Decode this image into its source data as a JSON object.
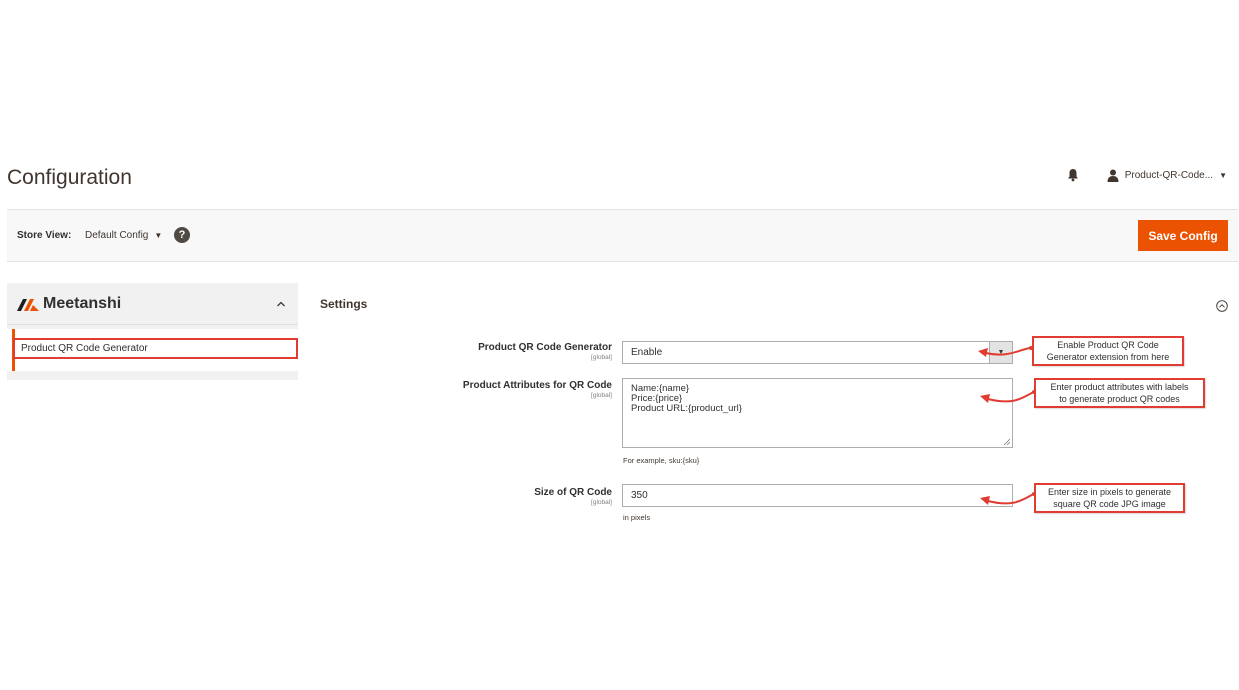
{
  "page": {
    "title": "Configuration"
  },
  "header": {
    "notifications_icon": "bell-icon",
    "user_label": "Product-QR-Code...",
    "user_icon": "user-icon"
  },
  "scope_bar": {
    "store_view_label": "Store View:",
    "store_view_value": "Default Config",
    "help_icon": "question-icon",
    "help_glyph": "?",
    "save_label": "Save Config"
  },
  "sidebar": {
    "brand": "Meetanshi",
    "items": [
      {
        "label": "Product QR Code Generator",
        "active": true
      }
    ]
  },
  "section": {
    "title": "Settings"
  },
  "fields": {
    "generator": {
      "label": "Product QR Code Generator",
      "scope": "[global]",
      "value": "Enable"
    },
    "attributes": {
      "label": "Product Attributes for QR Code",
      "scope": "[global]",
      "value": "Name:{name}\nPrice:{price}\nProduct URL:{product_url}",
      "note": "For example, sku:{sku}"
    },
    "size": {
      "label": "Size of QR Code",
      "scope": "[global]",
      "value": "350",
      "note": "in pixels"
    }
  },
  "callouts": {
    "generator": [
      "Enable Product QR Code",
      "Generator extension from here"
    ],
    "attributes": [
      "Enter product attributes with labels",
      "to generate product QR codes"
    ],
    "size": [
      "Enter size in pixels to generate",
      "square QR code JPG image"
    ]
  },
  "colors": {
    "accent": "#eb5202",
    "callout_border": "#e03c31",
    "text": "#303030"
  }
}
